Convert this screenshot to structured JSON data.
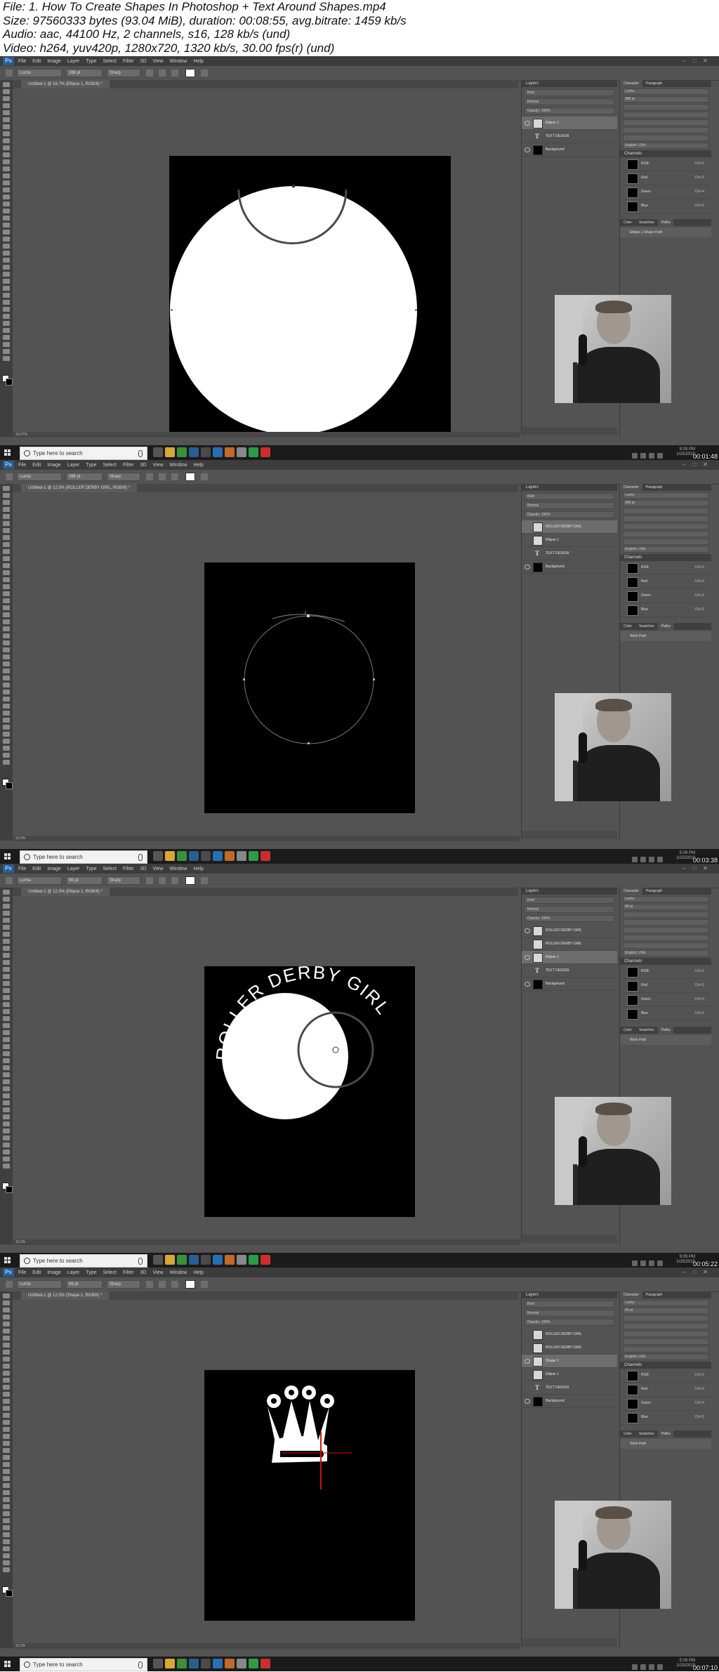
{
  "file_info": {
    "line1": "File: 1. How To Create Shapes In Photoshop + Text Around Shapes.mp4",
    "line2": "Size: 97560333 bytes (93.04 MiB), duration: 00:08:55, avg.bitrate: 1459 kb/s",
    "line3": "Audio: aac, 44100 Hz, 2 channels, s16, 128 kb/s (und)",
    "line4": "Video: h264, yuv420p, 1280x720, 1320 kb/s, 30.00 fps(r) (und)"
  },
  "menus": [
    "File",
    "Edit",
    "Image",
    "Layer",
    "Type",
    "Select",
    "Filter",
    "3D",
    "View",
    "Window",
    "Help"
  ],
  "taskbar": {
    "search_placeholder": "Type here to search",
    "tray_time": "5:09 PM",
    "tray_date": "1/15/2018"
  },
  "panels": {
    "layers_title": "Layers",
    "character_tab": "Character",
    "paragraph_tab": "Paragraph",
    "channels_title": "Channels",
    "paths_title": "Paths",
    "color_tab": "Color",
    "swatches_tab": "Swatches",
    "paths_tab": "Paths",
    "kind_label": "Kind",
    "blend_mode": "Normal",
    "opacity_label": "Opacity: 100%",
    "fill_label": "Fill: 100%",
    "font_name": "Lurrta",
    "language": "English: USA",
    "antialias": "Sharp"
  },
  "frames": [
    {
      "timestamp": "00:01:48",
      "doc_tab": "Untitled-1 @ 16.7% (Ellipse 1, RGB/8) *",
      "zoom": "16.67%",
      "font_size": "288 pt",
      "layers": [
        {
          "name": "Ellipse 1",
          "type": "shape",
          "visible": true,
          "selected": true
        },
        {
          "name": "TEXT DESIGN",
          "type": "text",
          "visible": false,
          "selected": false
        },
        {
          "name": "Background",
          "type": "fill-black",
          "visible": true,
          "selected": false
        }
      ],
      "paths_item": "Ellipse 1 Shape Path"
    },
    {
      "timestamp": "00:03:38",
      "doc_tab": "Untitled-1 @ 12.5% (ROLLER DERBY GIRL, RGB/8) *",
      "zoom": "12.5%",
      "font_size": "288 pt",
      "layers": [
        {
          "name": "ROLLER DERBY GIRL",
          "type": "shape",
          "visible": false,
          "selected": true
        },
        {
          "name": "Ellipse 1",
          "type": "shape",
          "visible": false,
          "selected": false
        },
        {
          "name": "TEXT DESIGN",
          "type": "text",
          "visible": false,
          "selected": false
        },
        {
          "name": "Background",
          "type": "fill-black",
          "visible": true,
          "selected": false
        }
      ],
      "paths_item": "Work Path"
    },
    {
      "timestamp": "00:05:22",
      "doc_tab": "Untitled-1 @ 12.5% (Ellipse 1, RGB/8) *",
      "zoom": "12.5%",
      "font_size": "96 pt",
      "curve_text": "ROLLER DERBY GIRL",
      "layers": [
        {
          "name": "ROLLER DERBY GIRL",
          "type": "shape",
          "visible": true,
          "selected": false
        },
        {
          "name": "ROLLER DERBY GIRL",
          "type": "shape",
          "visible": false,
          "selected": false
        },
        {
          "name": "Ellipse 1",
          "type": "shape",
          "visible": true,
          "selected": true
        },
        {
          "name": "TEXT DESIGN",
          "type": "text",
          "visible": false,
          "selected": false
        },
        {
          "name": "Background",
          "type": "fill-black",
          "visible": true,
          "selected": false
        }
      ],
      "paths_item": "Work Path"
    },
    {
      "timestamp": "00:07:10",
      "doc_tab": "Untitled-1 @ 12.5% (Shape 1, RGB/8) *",
      "zoom": "12.5%",
      "font_size": "96 pt",
      "layers": [
        {
          "name": "ROLLER DERBY GIRL",
          "type": "shape",
          "visible": false,
          "selected": false
        },
        {
          "name": "ROLLER DERBY GIRL",
          "type": "shape",
          "visible": false,
          "selected": false
        },
        {
          "name": "Shape 1",
          "type": "shape",
          "visible": true,
          "selected": true
        },
        {
          "name": "Ellipse 1",
          "type": "shape",
          "visible": false,
          "selected": false
        },
        {
          "name": "TEXT DESIGN",
          "type": "text",
          "visible": false,
          "selected": false
        },
        {
          "name": "Background",
          "type": "fill-black",
          "visible": true,
          "selected": false
        }
      ],
      "paths_item": "Work Path"
    }
  ],
  "channels": [
    {
      "name": "RGB",
      "shortcut": "Ctrl+2"
    },
    {
      "name": "Red",
      "shortcut": "Ctrl+3"
    },
    {
      "name": "Green",
      "shortcut": "Ctrl+4"
    },
    {
      "name": "Blue",
      "shortcut": "Ctrl+5"
    }
  ],
  "colors": {
    "ps_gray": "#535353",
    "ps_dark": "#3c3c3c",
    "canvas_black": "#000000",
    "shape_white": "#ffffff",
    "path_stroke": "#4a4a4a",
    "guide_red": "#cc1111",
    "taskbar": "#1b1b1b"
  }
}
